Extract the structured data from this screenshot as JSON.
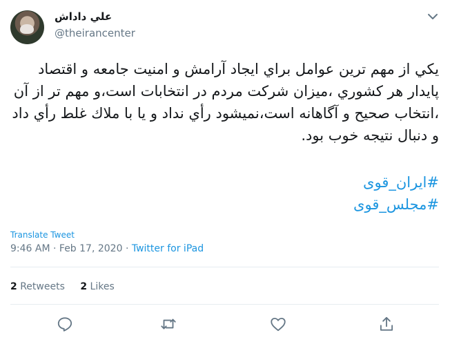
{
  "user": {
    "display_name": "علي داداش",
    "handle": "@theirancenter"
  },
  "tweet": {
    "text": "يكي از مهم ترين عوامل براي ايجاد آرامش و امنيت جامعه و اقتصاد پايدار هر كشوري ،ميزان شركت مردم در انتخابات است،و مهم تر از آن ،انتخاب صحيح و آگاهانه است،نميشود رأي نداد و يا با ملاك غلط رأي داد و دنبال نتيجه خوب بود.",
    "hashtags": [
      "#ایران_قوی",
      "#مجلس_قوی"
    ],
    "translate_label": "Translate Tweet",
    "time": "9:46 AM",
    "date": "Feb 17, 2020",
    "separator": "·",
    "source": "Twitter for iPad"
  },
  "stats": {
    "retweets_count": "2",
    "retweets_label": "Retweets",
    "likes_count": "2",
    "likes_label": "Likes"
  },
  "icons": {
    "caret": "chevron-down-icon",
    "reply": "reply-icon",
    "retweet": "retweet-icon",
    "like": "heart-icon",
    "share": "share-icon"
  },
  "colors": {
    "link": "#1b95e0",
    "muted": "#657786",
    "text": "#14171a",
    "divider": "#e6ecf0"
  }
}
